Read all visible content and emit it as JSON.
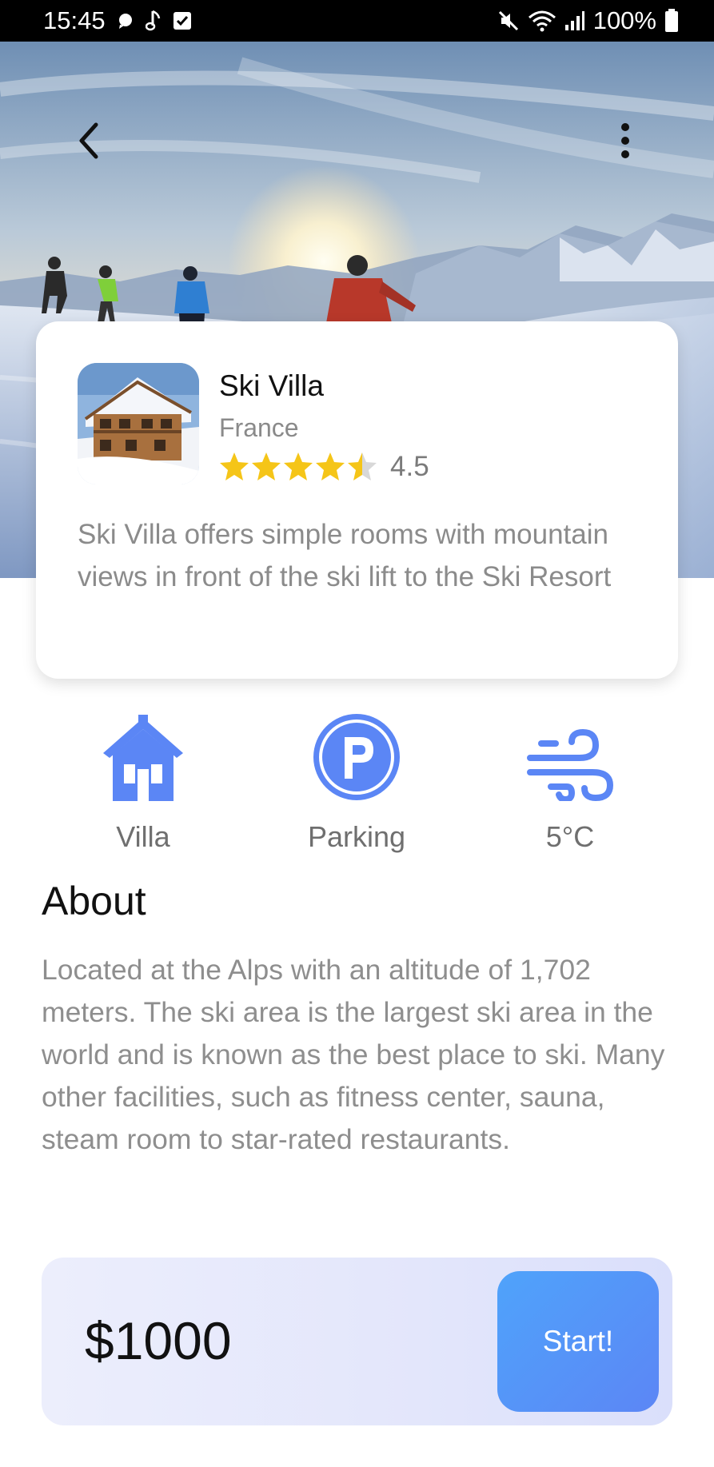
{
  "status_bar": {
    "time": "15:45",
    "battery": "100%",
    "left_icons": [
      "chat-bubble-icon",
      "music-note-icon",
      "checkbox-icon"
    ],
    "right_icons": [
      "mute-icon",
      "wifi-icon",
      "signal-icon",
      "battery-icon"
    ]
  },
  "header": {
    "back_icon": "chevron-left-icon",
    "menu_icon": "more-vertical-icon"
  },
  "listing": {
    "name": "Ski Villa",
    "country": "France",
    "rating": 4.5,
    "rating_label": "4.5",
    "rating_max": 5,
    "description": "Ski Villa offers simple rooms with mountain views in front of the ski lift to the Ski Resort"
  },
  "features": [
    {
      "icon": "house-icon",
      "label": "Villa"
    },
    {
      "icon": "parking-icon",
      "label": "Parking"
    },
    {
      "icon": "wind-icon",
      "label": "5°C"
    }
  ],
  "about": {
    "title": "About",
    "text": "Located at the Alps with an altitude of 1,702 meters. The ski area is the largest ski area in the world and is known as the best place to ski. Many other facilities, such as fitness center, sauna, steam room to star-rated restaurants."
  },
  "booking": {
    "price": "$1000",
    "button_label": "Start!"
  },
  "colors": {
    "accent": "#5b86f5",
    "star": "#f5c518",
    "star_empty": "#d8d8d8",
    "muted_text": "#8b8b8b"
  }
}
